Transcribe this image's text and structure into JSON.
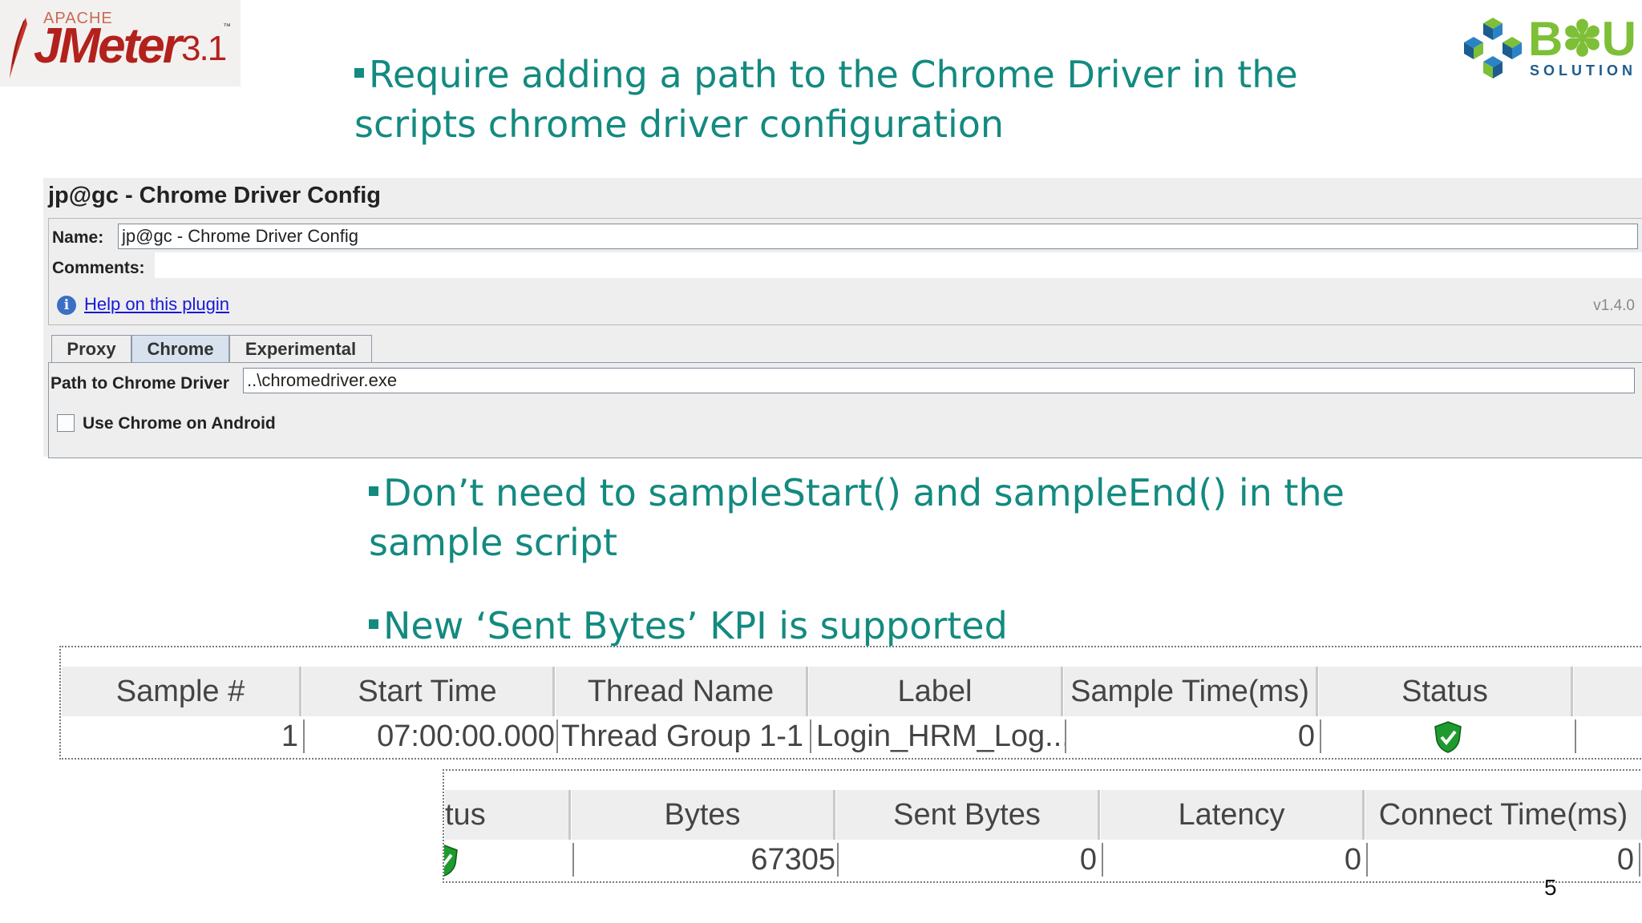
{
  "logo_left": {
    "apache": "APACHE",
    "name": "JMeter",
    "version": "3.1",
    "tm": "™"
  },
  "logo_right": {
    "word": "B✽U",
    "sub": "SOLUTION"
  },
  "bullets": [
    {
      "line1": "Require adding a path to the Chrome Driver in the",
      "line2": "scripts chrome driver configuration"
    },
    {
      "line1": "Don’t need to sampleStart() and sampleEnd() in the",
      "line2": "sample script"
    },
    {
      "line1": "New ‘Sent Bytes’ KPI is supported"
    }
  ],
  "config": {
    "title": "jp@gc - Chrome Driver Config",
    "name_label": "Name:",
    "name_value": "jp@gc - Chrome Driver Config",
    "comments_label": "Comments:",
    "help_link": "Help on this plugin",
    "version": "v1.4.0",
    "tabs": [
      "Proxy",
      "Chrome",
      "Experimental"
    ],
    "active_tab": "Chrome",
    "path_label": "Path to Chrome Driver",
    "path_value": "..\\chromedriver.exe",
    "android_label": "Use Chrome on Android",
    "android_checked": false
  },
  "results_table_1": {
    "headers": [
      "Sample #",
      "Start Time",
      "Thread Name",
      "Label",
      "Sample Time(ms)",
      "Status"
    ],
    "row": [
      "1",
      "07:00:00.000",
      "Thread Group 1-1",
      "Login_HRM_Log...",
      "0"
    ],
    "status_icon": "success-shield-icon"
  },
  "results_table_2": {
    "headers": [
      "tus",
      "Bytes",
      "Sent Bytes",
      "Latency",
      "Connect Time(ms)"
    ],
    "row": [
      "67305",
      "0",
      "0",
      "0"
    ],
    "status_icon": "success-shield-icon"
  },
  "colors": {
    "bullet_text": "#138a80",
    "link": "#1818d8",
    "status_ok": "#1e9b2e"
  },
  "page_number": "5"
}
